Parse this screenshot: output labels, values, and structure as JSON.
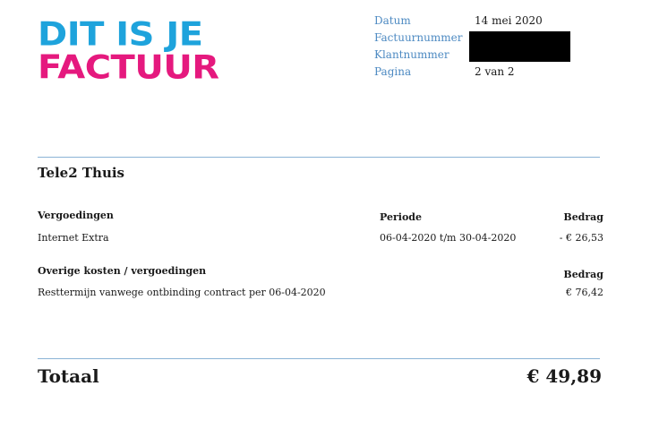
{
  "logo": {
    "line1": "DIT IS JE",
    "line2": "FACTUUR"
  },
  "meta": [
    {
      "label": "Datum",
      "value": "14 mei 2020"
    },
    {
      "label": "Factuurnummer",
      "value": ""
    },
    {
      "label": "Klantnummer",
      "value": ""
    },
    {
      "label": "Pagina",
      "value": "2 van 2"
    }
  ],
  "section": {
    "title": "Tele2 Thuis",
    "vergoedingen": {
      "heading": "Vergoedingen",
      "col_periode": "Periode",
      "col_bedrag": "Bedrag",
      "rows": [
        {
          "description": "Internet Extra",
          "periode": "06-04-2020 t/m 30-04-2020",
          "bedrag": "- € 26,53"
        }
      ]
    },
    "overige": {
      "heading": "Overige kosten / vergoedingen",
      "col_bedrag": "Bedrag",
      "rows": [
        {
          "description": "Resttermijn vanwege ontbinding contract per 06-04-2020",
          "bedrag": "€ 76,42"
        }
      ]
    }
  },
  "total": {
    "label": "Totaal",
    "value": "€ 49,89"
  },
  "colors": {
    "logo_blue": "#1ea3dc",
    "logo_pink": "#e5197e",
    "label_blue": "#4d8ac2",
    "rule": "#8bb3d6"
  }
}
